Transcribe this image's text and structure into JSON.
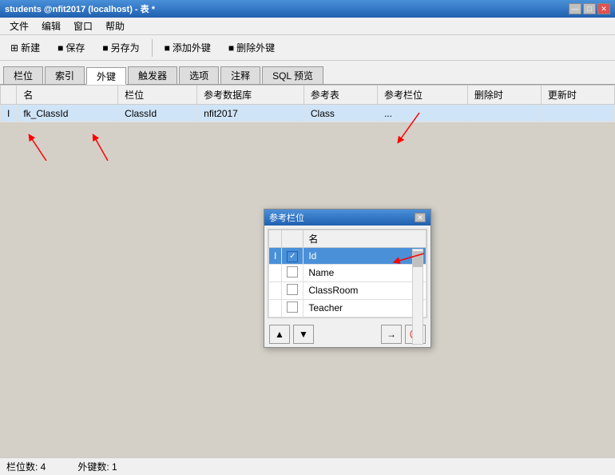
{
  "window": {
    "title": "students @nfit2017 (localhost) - 表 *",
    "controls": [
      "—",
      "□",
      "✕"
    ]
  },
  "menu": {
    "items": [
      "文件",
      "编辑",
      "窗口",
      "帮助"
    ]
  },
  "toolbar": {
    "buttons": [
      {
        "id": "new",
        "label": "新建",
        "icon": "new"
      },
      {
        "id": "save",
        "label": "保存",
        "icon": "save"
      },
      {
        "id": "saveas",
        "label": "另存为",
        "icon": "saveas"
      },
      {
        "id": "addkey",
        "label": "添加外键",
        "icon": "addkey"
      },
      {
        "id": "delkey",
        "label": "删除外键",
        "icon": "delkey"
      }
    ]
  },
  "tabs": {
    "items": [
      "栏位",
      "索引",
      "外键",
      "触发器",
      "选项",
      "注释",
      "SQL 预览"
    ],
    "active": "外键"
  },
  "table": {
    "columns": [
      "名",
      "栏位",
      "参考数据库",
      "参考表",
      "参考栏位",
      "删除时",
      "更新时"
    ],
    "rows": [
      {
        "indicator": "I",
        "selected": true,
        "name": "fk_ClassId",
        "column": "ClassId",
        "ref_db": "nfit2017",
        "ref_table": "Class",
        "ref_col": "...",
        "del_action": "",
        "upd_action": ""
      }
    ]
  },
  "popup": {
    "title": "参考栏位",
    "column_header": "名",
    "rows": [
      {
        "indicator": "I",
        "name": "Id",
        "checked": true,
        "selected": true
      },
      {
        "indicator": "",
        "name": "Name",
        "checked": false,
        "selected": false
      },
      {
        "indicator": "",
        "name": "ClassRoom",
        "checked": false,
        "selected": false
      },
      {
        "indicator": "",
        "name": "Teacher",
        "checked": false,
        "selected": false
      }
    ],
    "footer_buttons_left": [
      "▲",
      "▼"
    ],
    "footer_buttons_right": [
      "→",
      "🚫"
    ]
  },
  "status": {
    "columns": "栏位数: 4",
    "foreign_keys": "外键数: 1"
  },
  "arrows": [
    {
      "id": "arrow1",
      "label": "fk_ClassId arrow"
    },
    {
      "id": "arrow2",
      "label": "ClassId arrow"
    },
    {
      "id": "arrow3",
      "label": "ref_col arrow"
    },
    {
      "id": "arrow4",
      "label": "Id arrow"
    }
  ]
}
